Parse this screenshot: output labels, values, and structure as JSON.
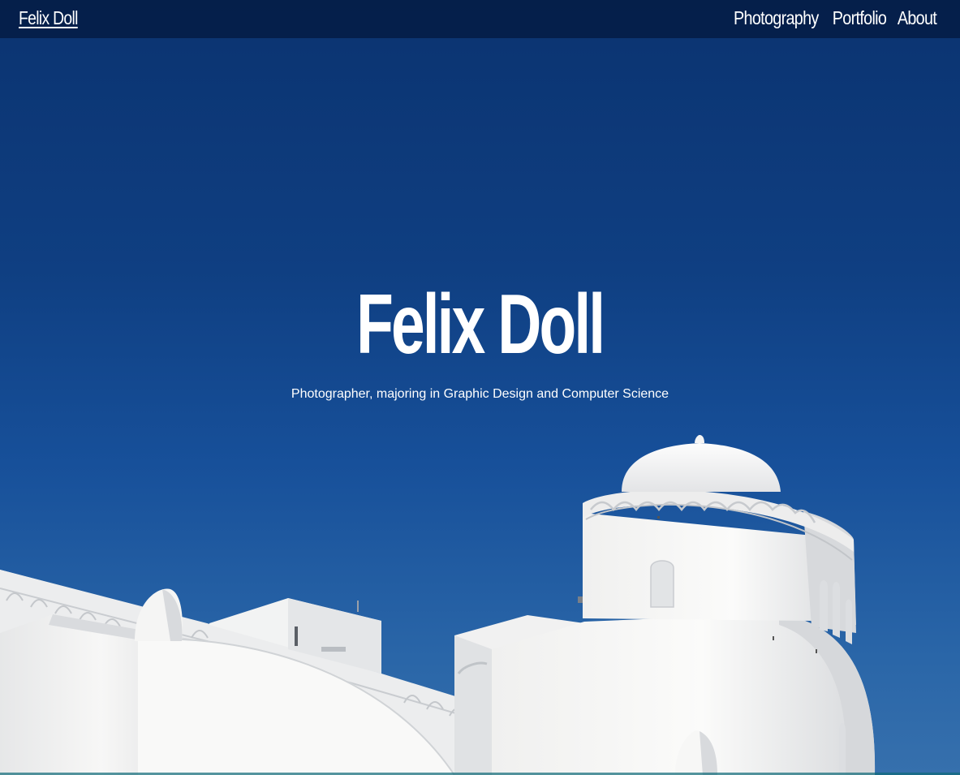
{
  "nav": {
    "brand": "Felix Doll",
    "links": [
      {
        "label": "Photography"
      },
      {
        "label": "Portfolio"
      },
      {
        "label": "About"
      }
    ]
  },
  "hero": {
    "title": "Felix Doll",
    "subtitle": "Photographer, majoring in Graphic Design and Computer Science"
  },
  "colors": {
    "sky": "#0f3f82",
    "topbar": "#041a40",
    "text": "#ffffff",
    "building": "#f4f4f2"
  }
}
